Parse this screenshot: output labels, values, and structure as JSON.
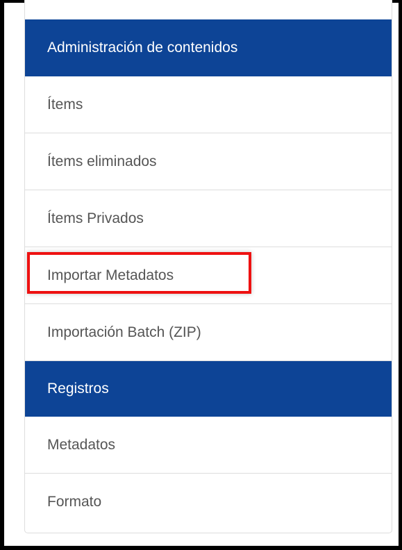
{
  "sections": [
    {
      "header": "Administración de contenidos",
      "items": [
        {
          "label": "Ítems"
        },
        {
          "label": "Ítems eliminados"
        },
        {
          "label": "Ítems Privados"
        },
        {
          "label": "Importar Metadatos",
          "highlighted": true
        },
        {
          "label": "Importación Batch (ZIP)"
        }
      ]
    },
    {
      "header": "Registros",
      "items": [
        {
          "label": "Metadatos"
        },
        {
          "label": "Formato"
        }
      ]
    }
  ],
  "colors": {
    "header_bg": "#0d4496",
    "header_text": "#ffffff",
    "item_text": "#555555",
    "highlight_border": "#ee1111"
  }
}
